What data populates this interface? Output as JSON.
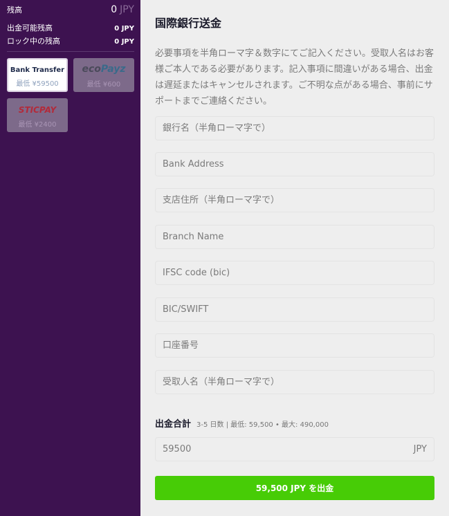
{
  "sidebar": {
    "balance_label": "残高",
    "balance_value": "0",
    "balance_currency": "JPY",
    "withdrawable_label": "出金可能残高",
    "withdrawable_value": "0 JPY",
    "locked_label": "ロック中の残高",
    "locked_value": "0 JPY",
    "methods": [
      {
        "name": "Bank Transfer",
        "min": "最低 ¥59500"
      },
      {
        "name_a": "eco",
        "name_b": "Payz",
        "min": "最低 ¥600"
      },
      {
        "name": "STICPAY",
        "min": "最低 ¥2400"
      }
    ]
  },
  "main": {
    "title": "国際銀行送金",
    "description": "必要事項を半角ローマ字＆数字にてご記入ください。受取人名はお客様ご本人である必要があります。記入事項に間違いがある場合、出金は遅延またはキャンセルされます。ご不明な点がある場合、事前にサポートまでご連絡ください。",
    "fields": [
      {
        "placeholder": "銀行名（半角ローマ字で）"
      },
      {
        "placeholder": "Bank Address"
      },
      {
        "placeholder": "支店住所（半角ローマ字で）"
      },
      {
        "placeholder": "Branch Name"
      },
      {
        "placeholder": "IFSC code (bic)"
      },
      {
        "placeholder": "BIC/SWIFT"
      },
      {
        "placeholder": "口座番号"
      },
      {
        "placeholder": "受取人名（半角ローマ字で）"
      }
    ],
    "total_label": "出金合計",
    "total_info": "3-5 日数 | 最低: 59,500 • 最大: 490,000",
    "amount_value": "59500",
    "amount_currency": "JPY",
    "submit_label": "59,500 JPY を出金"
  }
}
